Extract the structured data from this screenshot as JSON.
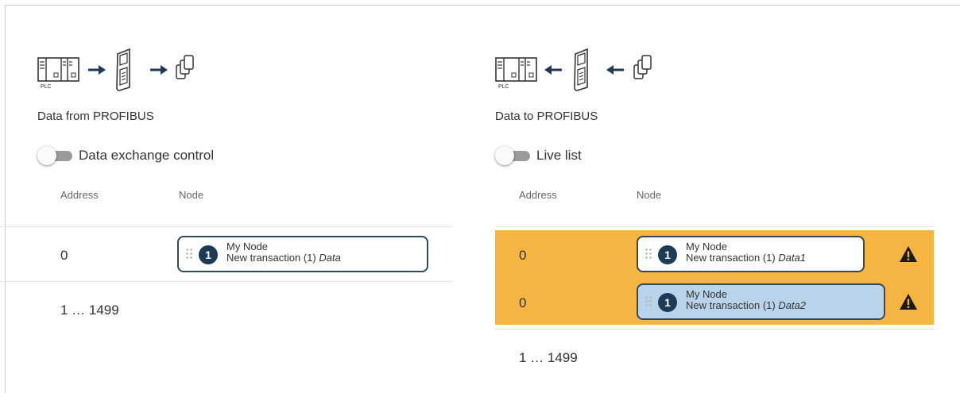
{
  "left_panel": {
    "title": "Data from PROFIBUS",
    "toggle_label": "Data exchange control",
    "col_address": "Address",
    "col_node": "Node",
    "rows": [
      {
        "address": "0",
        "node_name": "My Node",
        "transaction": "New transaction (1)",
        "data": "Data",
        "number": "1"
      }
    ],
    "range_label": "1 … 1499"
  },
  "right_panel": {
    "title": "Data to PROFIBUS",
    "toggle_label": "Live list",
    "col_address": "Address",
    "col_node": "Node",
    "rows": [
      {
        "address": "0",
        "node_name": "My Node",
        "transaction": "New transaction (1)",
        "data": "Data1",
        "number": "1",
        "warning": true
      },
      {
        "address": "0",
        "node_name": "My Node",
        "transaction": "New transaction (1)",
        "data": "Data2",
        "number": "1",
        "warning": true,
        "selected": true
      }
    ],
    "range_label": "1 … 1499"
  },
  "diagram": {
    "plc_label": "PLC"
  },
  "colors": {
    "highlight": "#f6b443",
    "node_border": "#2f4a61",
    "badge": "#1d3a56",
    "selected_card": "#b9d3ea"
  },
  "icons": [
    "plc-icon",
    "gateway-icon",
    "data-pages-icon",
    "arrow-icon",
    "drag-handle-icon",
    "warning-icon"
  ]
}
